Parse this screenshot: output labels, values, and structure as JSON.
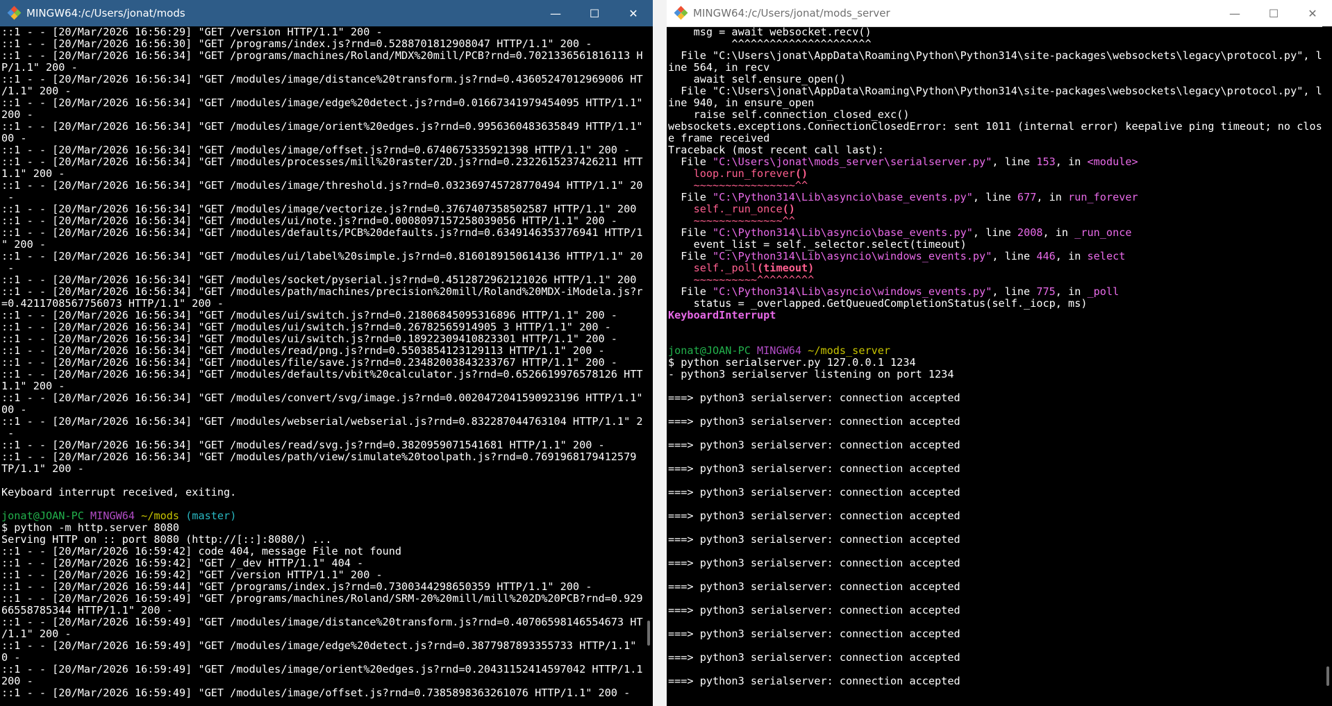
{
  "left_window": {
    "title": "MINGW64:/c/Users/jonat/mods",
    "lines": [
      [
        {
          "t": "::1 - - [20/Mar/2026 16:56:29] \"GET /version HTTP/1.1\" 200 -"
        }
      ],
      [
        {
          "t": "::1 - - [20/Mar/2026 16:56:30] \"GET /programs/index.js?rnd=0.5288701812908047 HTTP/1.1\" 200 -"
        }
      ],
      [
        {
          "t": "::1 - - [20/Mar/2026 16:56:34] \"GET /programs/machines/Roland/MDX%20mill/PCB?rnd=0.7021336561816113 HTT"
        }
      ],
      [
        {
          "t": "P/1.1\" 200 -"
        }
      ],
      [
        {
          "t": "::1 - - [20/Mar/2026 16:56:34] \"GET /modules/image/distance%20transform.js?rnd=0.43605247012969006 HTTP"
        }
      ],
      [
        {
          "t": "/1.1\" 200 -"
        }
      ],
      [
        {
          "t": "::1 - - [20/Mar/2026 16:56:34] \"GET /modules/image/edge%20detect.js?rnd=0.01667341979454095 HTTP/1.1\""
        }
      ],
      [
        {
          "t": "200 -"
        }
      ],
      [
        {
          "t": "::1 - - [20/Mar/2026 16:56:34] \"GET /modules/image/orient%20edges.js?rnd=0.9956360483635849 HTTP/1.1\" 2"
        }
      ],
      [
        {
          "t": "00 -"
        }
      ],
      [
        {
          "t": "::1 - - [20/Mar/2026 16:56:34] \"GET /modules/image/offset.js?rnd=0.6740675335921398 HTTP/1.1\" 200 -"
        }
      ],
      [
        {
          "t": "::1 - - [20/Mar/2026 16:56:34] \"GET /modules/processes/mill%20raster/2D.js?rnd=0.2322615237426211 HTTP/"
        }
      ],
      [
        {
          "t": "1.1\" 200 -"
        }
      ],
      [
        {
          "t": "::1 - - [20/Mar/2026 16:56:34] \"GET /modules/image/threshold.js?rnd=0.032369745728770494 HTTP/1.1\" 200"
        }
      ],
      [
        {
          "t": " -"
        }
      ],
      [
        {
          "t": "::1 - - [20/Mar/2026 16:56:34] \"GET /modules/image/vectorize.js?rnd=0.3767407358502587 HTTP/1.1\" 200 -"
        }
      ],
      [
        {
          "t": "::1 - - [20/Mar/2026 16:56:34] \"GET /modules/ui/note.js?rnd=0.0008097157258039056 HTTP/1.1\" 200 -"
        }
      ],
      [
        {
          "t": "::1 - - [20/Mar/2026 16:56:34] \"GET /modules/defaults/PCB%20defaults.js?rnd=0.6349146353776941 HTTP/1.1"
        }
      ],
      [
        {
          "t": "\" 200 -"
        }
      ],
      [
        {
          "t": "::1 - - [20/Mar/2026 16:56:34] \"GET /modules/ui/label%20simple.js?rnd=0.8160189150614136 HTTP/1.1\" 200"
        }
      ],
      [
        {
          "t": " -"
        }
      ],
      [
        {
          "t": "::1 - - [20/Mar/2026 16:56:34] \"GET /modules/socket/pyserial.js?rnd=0.4512872962121026 HTTP/1.1\" 200 -"
        }
      ],
      [
        {
          "t": "::1 - - [20/Mar/2026 16:56:34] \"GET /modules/path/machines/precision%20mill/Roland%20MDX-iModela.js?rnd"
        }
      ],
      [
        {
          "t": "=0.4211708567756073 HTTP/1.1\" 200 -"
        }
      ],
      [
        {
          "t": "::1 - - [20/Mar/2026 16:56:34] \"GET /modules/ui/switch.js?rnd=0.21806845095316896 HTTP/1.1\" 200 -"
        }
      ],
      [
        {
          "t": "::1 - - [20/Mar/2026 16:56:34] \"GET /modules/ui/switch.js?rnd=0.26782565914905 3 HTTP/1.1\" 200 -"
        }
      ],
      [
        {
          "t": "::1 - - [20/Mar/2026 16:56:34] \"GET /modules/ui/switch.js?rnd=0.18922309410823301 HTTP/1.1\" 200 -"
        }
      ],
      [
        {
          "t": "::1 - - [20/Mar/2026 16:56:34] \"GET /modules/read/png.js?rnd=0.5503854123129113 HTTP/1.1\" 200 -"
        }
      ],
      [
        {
          "t": "::1 - - [20/Mar/2026 16:56:34] \"GET /modules/file/save.js?rnd=0.23482003843233767 HTTP/1.1\" 200 -"
        }
      ],
      [
        {
          "t": "::1 - - [20/Mar/2026 16:56:34] \"GET /modules/defaults/vbit%20calculator.js?rnd=0.6526619976578126 HTTP/"
        }
      ],
      [
        {
          "t": "1.1\" 200 -"
        }
      ],
      [
        {
          "t": "::1 - - [20/Mar/2026 16:56:34] \"GET /modules/convert/svg/image.js?rnd=0.0020472041590923196 HTTP/1.1\" 2"
        }
      ],
      [
        {
          "t": "00 -"
        }
      ],
      [
        {
          "t": "::1 - - [20/Mar/2026 16:56:34] \"GET /modules/webserial/webserial.js?rnd=0.832287044763104 HTTP/1.1\" 200"
        }
      ],
      [
        {
          "t": " -"
        }
      ],
      [
        {
          "t": "::1 - - [20/Mar/2026 16:56:34] \"GET /modules/read/svg.js?rnd=0.3820959071541681 HTTP/1.1\" 200 -"
        }
      ],
      [
        {
          "t": "::1 - - [20/Mar/2026 16:56:34] \"GET /modules/path/view/simulate%20toolpath.js?rnd=0.7691968179412579 HT"
        }
      ],
      [
        {
          "t": "TP/1.1\" 200 -"
        }
      ],
      [
        {
          "t": ""
        }
      ],
      [
        {
          "t": "Keyboard interrupt received, exiting."
        }
      ],
      [
        {
          "t": ""
        }
      ],
      [
        {
          "t": "jonat@JOAN-PC ",
          "c": "green"
        },
        {
          "t": "MINGW64 ",
          "c": "purple"
        },
        {
          "t": "~/mods ",
          "c": "yellow"
        },
        {
          "t": "(master)",
          "c": "cyan"
        }
      ],
      [
        {
          "t": "$ python -m http.server 8080"
        }
      ],
      [
        {
          "t": "Serving HTTP on :: port 8080 (http://[::]:8080/) ..."
        }
      ],
      [
        {
          "t": "::1 - - [20/Mar/2026 16:59:42] code 404, message File not found"
        }
      ],
      [
        {
          "t": "::1 - - [20/Mar/2026 16:59:42] \"GET /_dev HTTP/1.1\" 404 -"
        }
      ],
      [
        {
          "t": "::1 - - [20/Mar/2026 16:59:42] \"GET /version HTTP/1.1\" 200 -"
        }
      ],
      [
        {
          "t": "::1 - - [20/Mar/2026 16:59:44] \"GET /programs/index.js?rnd=0.7300344298650359 HTTP/1.1\" 200 -"
        }
      ],
      [
        {
          "t": "::1 - - [20/Mar/2026 16:59:49] \"GET /programs/machines/Roland/SRM-20%20mill/mill%202D%20PCB?rnd=0.92966"
        }
      ],
      [
        {
          "t": "66558785344 HTTP/1.1\" 200 -"
        }
      ],
      [
        {
          "t": "::1 - - [20/Mar/2026 16:59:49] \"GET /modules/image/distance%20transform.js?rnd=0.40706598146554673 HTTP"
        }
      ],
      [
        {
          "t": "/1.1\" 200 -"
        }
      ],
      [
        {
          "t": "::1 - - [20/Mar/2026 16:59:49] \"GET /modules/image/edge%20detect.js?rnd=0.3877987893355733 HTTP/1.1\" 20"
        }
      ],
      [
        {
          "t": "0 -"
        }
      ],
      [
        {
          "t": "::1 - - [20/Mar/2026 16:59:49] \"GET /modules/image/orient%20edges.js?rnd=0.20431152414597042 HTTP/1.1\""
        }
      ],
      [
        {
          "t": "200 -"
        }
      ],
      [
        {
          "t": "::1 - - [20/Mar/2026 16:59:49] \"GET /modules/image/offset.js?rnd=0.7385898363261076 HTTP/1.1\" 200 -"
        }
      ]
    ]
  },
  "right_window": {
    "title": "MINGW64:/c/Users/jonat/mods_server",
    "lines": [
      [
        {
          "t": "    msg = await websocket.recv()"
        }
      ],
      [
        {
          "t": "          ^^^^^^^^^^^^^^^^^^^^^^"
        }
      ],
      [
        {
          "t": "  File \"C:\\Users\\jonat\\AppData\\Roaming\\Python\\Python314\\site-packages\\websockets\\legacy\\protocol.py\", l"
        }
      ],
      [
        {
          "t": "ine 564, in recv"
        }
      ],
      [
        {
          "t": "    await self.ensure_open()"
        }
      ],
      [
        {
          "t": "  File \"C:\\Users\\jonat\\AppData\\Roaming\\Python\\Python314\\site-packages\\websockets\\legacy\\protocol.py\", l"
        }
      ],
      [
        {
          "t": "ine 940, in ensure_open"
        }
      ],
      [
        {
          "t": "    raise self.connection_closed_exc()"
        }
      ],
      [
        {
          "t": "websockets.exceptions.ConnectionClosedError: sent 1011 (internal error) keepalive ping timeout; no clos"
        }
      ],
      [
        {
          "t": "e frame received"
        }
      ],
      [
        {
          "t": "Traceback (most recent call last):"
        }
      ],
      [
        {
          "t": "  File "
        },
        {
          "t": "\"C:\\Users\\jonat\\mods_server\\serialserver.py\"",
          "c": "magenta"
        },
        {
          "t": ", line "
        },
        {
          "t": "153",
          "c": "magenta"
        },
        {
          "t": ", in "
        },
        {
          "t": "<module>",
          "c": "magenta"
        }
      ],
      [
        {
          "t": "    "
        },
        {
          "t": "loop.run_forever",
          "c": "red"
        },
        {
          "t": "()",
          "c": "redb"
        }
      ],
      [
        {
          "t": "    ~~~~~~~~~~~~~~~~^^",
          "c": "red"
        }
      ],
      [
        {
          "t": "  File "
        },
        {
          "t": "\"C:\\Python314\\Lib\\asyncio\\base_events.py\"",
          "c": "magenta"
        },
        {
          "t": ", line "
        },
        {
          "t": "677",
          "c": "magenta"
        },
        {
          "t": ", in "
        },
        {
          "t": "run_forever",
          "c": "magenta"
        }
      ],
      [
        {
          "t": "    "
        },
        {
          "t": "self._run_once",
          "c": "red"
        },
        {
          "t": "()",
          "c": "redb"
        }
      ],
      [
        {
          "t": "    ~~~~~~~~~~~~~~^^",
          "c": "red"
        }
      ],
      [
        {
          "t": "  File "
        },
        {
          "t": "\"C:\\Python314\\Lib\\asyncio\\base_events.py\"",
          "c": "magenta"
        },
        {
          "t": ", line "
        },
        {
          "t": "2008",
          "c": "magenta"
        },
        {
          "t": ", in "
        },
        {
          "t": "_run_once",
          "c": "magenta"
        }
      ],
      [
        {
          "t": "    event_list = self._selector.select(timeout)"
        }
      ],
      [
        {
          "t": "  File "
        },
        {
          "t": "\"C:\\Python314\\Lib\\asyncio\\windows_events.py\"",
          "c": "magenta"
        },
        {
          "t": ", line "
        },
        {
          "t": "446",
          "c": "magenta"
        },
        {
          "t": ", in "
        },
        {
          "t": "select",
          "c": "magenta"
        }
      ],
      [
        {
          "t": "    "
        },
        {
          "t": "self._poll",
          "c": "red"
        },
        {
          "t": "(timeout)",
          "c": "redb"
        }
      ],
      [
        {
          "t": "    ~~~~~~~~~~^^^^^^^^^",
          "c": "red"
        }
      ],
      [
        {
          "t": "  File "
        },
        {
          "t": "\"C:\\Python314\\Lib\\asyncio\\windows_events.py\"",
          "c": "magenta"
        },
        {
          "t": ", line "
        },
        {
          "t": "775",
          "c": "magenta"
        },
        {
          "t": ", in "
        },
        {
          "t": "_poll",
          "c": "magenta"
        }
      ],
      [
        {
          "t": "    status = _overlapped.GetQueuedCompletionStatus(self._iocp, ms)"
        }
      ],
      [
        {
          "t": "KeyboardInterrupt",
          "c": "magb"
        }
      ],
      [
        {
          "t": ""
        }
      ],
      [
        {
          "t": ""
        }
      ],
      [
        {
          "t": "jonat@JOAN-PC ",
          "c": "green"
        },
        {
          "t": "MINGW64 ",
          "c": "purple"
        },
        {
          "t": "~/mods_server",
          "c": "yellow"
        }
      ],
      [
        {
          "t": "$ python serialserver.py 127.0.0.1 1234"
        }
      ],
      [
        {
          "t": "- python3 serialserver listening on port 1234"
        }
      ],
      [
        {
          "t": ""
        }
      ],
      [
        {
          "t": "===> python3 serialserver: connection accepted"
        }
      ],
      [
        {
          "t": ""
        }
      ],
      [
        {
          "t": "===> python3 serialserver: connection accepted"
        }
      ],
      [
        {
          "t": ""
        }
      ],
      [
        {
          "t": "===> python3 serialserver: connection accepted"
        }
      ],
      [
        {
          "t": ""
        }
      ],
      [
        {
          "t": "===> python3 serialserver: connection accepted"
        }
      ],
      [
        {
          "t": ""
        }
      ],
      [
        {
          "t": "===> python3 serialserver: connection accepted"
        }
      ],
      [
        {
          "t": ""
        }
      ],
      [
        {
          "t": "===> python3 serialserver: connection accepted"
        }
      ],
      [
        {
          "t": ""
        }
      ],
      [
        {
          "t": "===> python3 serialserver: connection accepted"
        }
      ],
      [
        {
          "t": ""
        }
      ],
      [
        {
          "t": "===> python3 serialserver: connection accepted"
        }
      ],
      [
        {
          "t": ""
        }
      ],
      [
        {
          "t": "===> python3 serialserver: connection accepted"
        }
      ],
      [
        {
          "t": ""
        }
      ],
      [
        {
          "t": "===> python3 serialserver: connection accepted"
        }
      ],
      [
        {
          "t": ""
        }
      ],
      [
        {
          "t": "===> python3 serialserver: connection accepted"
        }
      ],
      [
        {
          "t": ""
        }
      ],
      [
        {
          "t": "===> python3 serialserver: connection accepted"
        }
      ],
      [
        {
          "t": ""
        }
      ],
      [
        {
          "t": "===> python3 serialserver: connection accepted"
        }
      ]
    ]
  },
  "controls": {
    "minimize": "—",
    "maximize": "☐",
    "close": "✕"
  },
  "icons": {
    "app": "git-bash-icon"
  }
}
